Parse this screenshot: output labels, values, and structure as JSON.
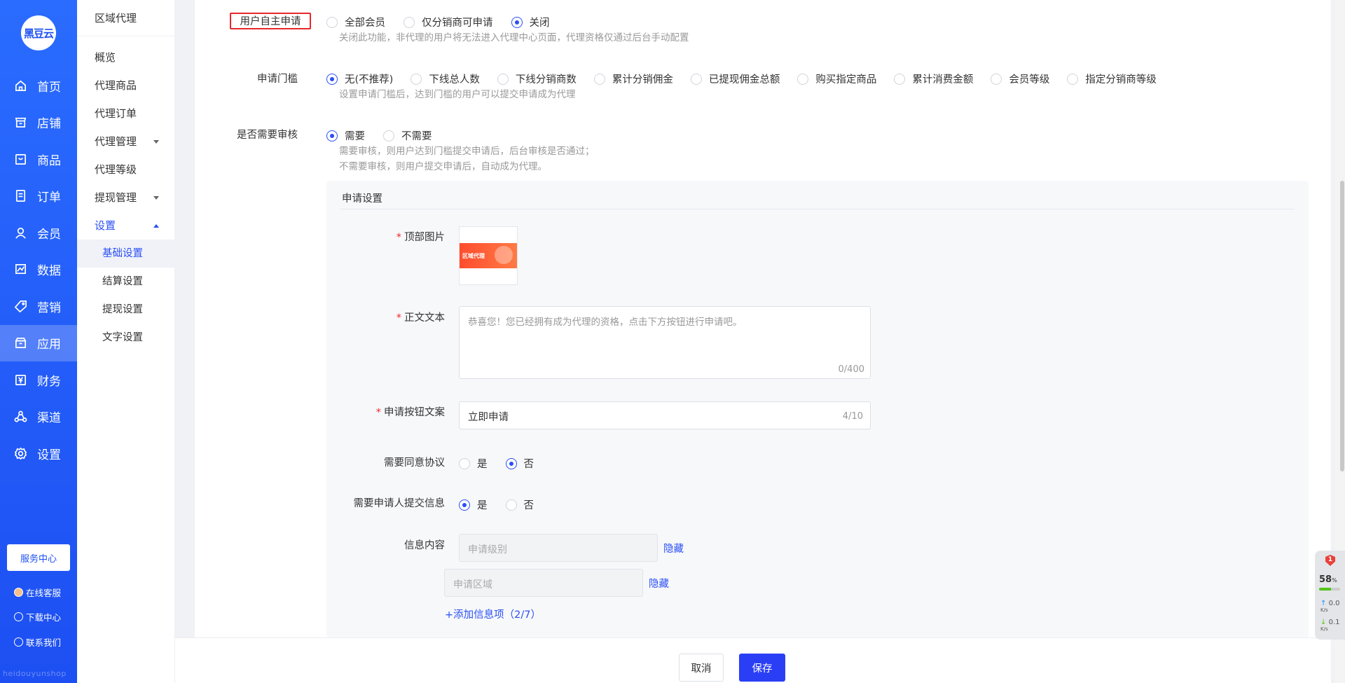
{
  "brand": {
    "logo_text": "黑豆云"
  },
  "nav": {
    "items": [
      {
        "label": "首页",
        "icon": "home-icon"
      },
      {
        "label": "店铺",
        "icon": "shop-icon"
      },
      {
        "label": "商品",
        "icon": "goods-icon"
      },
      {
        "label": "订单",
        "icon": "order-icon"
      },
      {
        "label": "会员",
        "icon": "user-icon"
      },
      {
        "label": "数据",
        "icon": "chart-icon"
      },
      {
        "label": "营销",
        "icon": "tag-icon"
      },
      {
        "label": "应用",
        "icon": "app-icon"
      },
      {
        "label": "财务",
        "icon": "finance-icon"
      },
      {
        "label": "渠道",
        "icon": "channel-icon"
      },
      {
        "label": "设置",
        "icon": "gear-icon"
      }
    ],
    "active": "应用",
    "service_center": "服务中心",
    "online_service": "在线客服",
    "download_center": "下载中心",
    "contact_us": "联系我们",
    "watermark": "heidouyunshop"
  },
  "subnav": {
    "title": "区域代理",
    "items": [
      "概览",
      "代理商品",
      "代理订单",
      "代理管理",
      "代理等级",
      "提现管理",
      "设置"
    ],
    "children": [
      "基础设置",
      "结算设置",
      "提现设置",
      "文字设置"
    ],
    "active_child": "基础设置"
  },
  "form": {
    "self_apply": {
      "label": "用户自主申请",
      "options": [
        "全部会员",
        "仅分销商可申请",
        "关闭"
      ],
      "selected": "关闭",
      "hint": "关闭此功能，非代理的用户将无法进入代理中心页面，代理资格仅通过后台手动配置"
    },
    "threshold": {
      "label": "申请门槛",
      "options": [
        "无(不推荐)",
        "下线总人数",
        "下线分销商数",
        "累计分销佣金",
        "已提现佣金总额",
        "购买指定商品",
        "累计消费金额",
        "会员等级",
        "指定分销商等级"
      ],
      "selected": "无(不推荐)",
      "hint": "设置申请门槛后，达到门槛的用户可以提交申请成为代理"
    },
    "review": {
      "label": "是否需要审核",
      "options": [
        "需要",
        "不需要"
      ],
      "selected": "需要",
      "hint1": "需要审核，则用户达到门槛提交申请后，后台审核是否通过；",
      "hint2": "不需要审核，则用户提交申请后，自动成为代理。"
    },
    "apply_settings": {
      "title": "申请设置",
      "top_image_label": "顶部图片",
      "top_image_text": "区域代理",
      "body_label": "正文文本",
      "body_placeholder": "恭喜您！您已经拥有成为代理的资格，点击下方按钮进行申请吧。",
      "body_counter": "0/400",
      "button_label": "申请按钮文案",
      "button_value": "立即申请",
      "button_counter": "4/10",
      "agree_label": "需要同意协议",
      "agree_options": [
        "是",
        "否"
      ],
      "agree_selected": "否",
      "submit_info_label": "需要申请人提交信息",
      "submit_info_options": [
        "是",
        "否"
      ],
      "submit_info_selected": "是",
      "info_label": "信息内容",
      "info_item1": "申请级别",
      "info_item2": "申请区域",
      "hide_label": "隐藏",
      "add_info": "+添加信息项（2/7）"
    }
  },
  "footer": {
    "cancel": "取消",
    "save": "保存"
  },
  "widget": {
    "badge": "1",
    "percent": "58",
    "percent_unit": "%",
    "percent_value": 0.58,
    "up": "0.0",
    "down": "0.1",
    "unit": "K/s"
  }
}
